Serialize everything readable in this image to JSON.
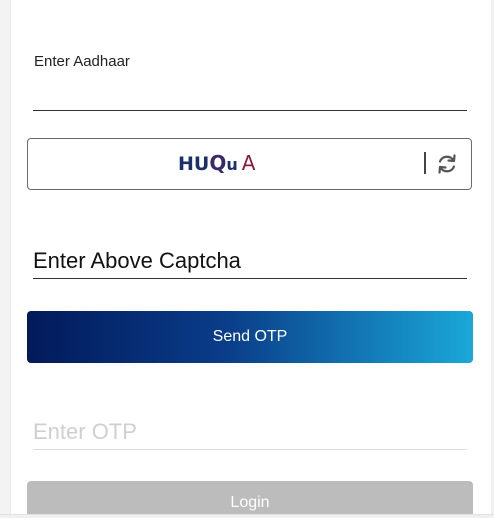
{
  "form": {
    "aadhaar_label": "Enter Aadhaar",
    "aadhaar_value": "",
    "captcha": {
      "chars": [
        "H",
        "U",
        "Q",
        "u",
        "A"
      ]
    },
    "captcha_input_placeholder": "Enter Above Captcha",
    "send_otp_label": "Send OTP",
    "otp_placeholder": "Enter OTP",
    "login_label": "Login"
  },
  "icons": {
    "refresh": "refresh-icon"
  },
  "colors": {
    "send_gradient_start": "#031a5a",
    "send_gradient_end": "#1aa8d8",
    "login_disabled": "#bcbcbc",
    "captcha_text": "#1b2f6b",
    "captcha_accent": "#8b1a3a"
  }
}
